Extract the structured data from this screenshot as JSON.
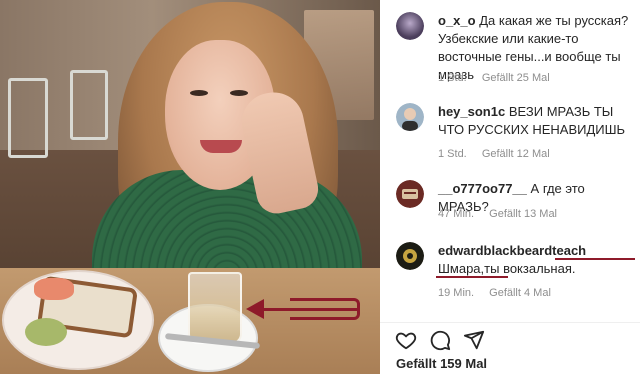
{
  "comments": [
    {
      "username": "o_x_o",
      "text": "Да какая же ты русская? Узбекские или какие-то восточные гены...и вообще ты мразь",
      "time": "1 Std.",
      "likes": "Gefällt 25 Mal"
    },
    {
      "username": "hey_son1c",
      "text": "ВЕЗИ МРАЗЬ ТЫ ЧТО РУССКИХ НЕНАВИДИШЬ",
      "time": "1 Std.",
      "likes": "Gefällt 12 Mal"
    },
    {
      "username": "__o777oo77__",
      "text": "А где это МРАЗЬ?",
      "time": "47 Min.",
      "likes": "Gefällt 13 Mal"
    },
    {
      "username": "edwardblackbeardteach",
      "text": "Шмара,ты вокзальная.",
      "time": "19 Min.",
      "likes": "Gefällt 4 Mal"
    }
  ],
  "actions": {
    "likes_count": "Gefällt 159 Mal"
  },
  "colors": {
    "annotation": "#8e1a2a",
    "meta_text": "#8e8e8e",
    "primary_text": "#262626"
  },
  "icons": {
    "like": "heart-icon",
    "comment": "comment-icon",
    "share": "share-icon",
    "comment_like": "heart-outline-icon"
  }
}
